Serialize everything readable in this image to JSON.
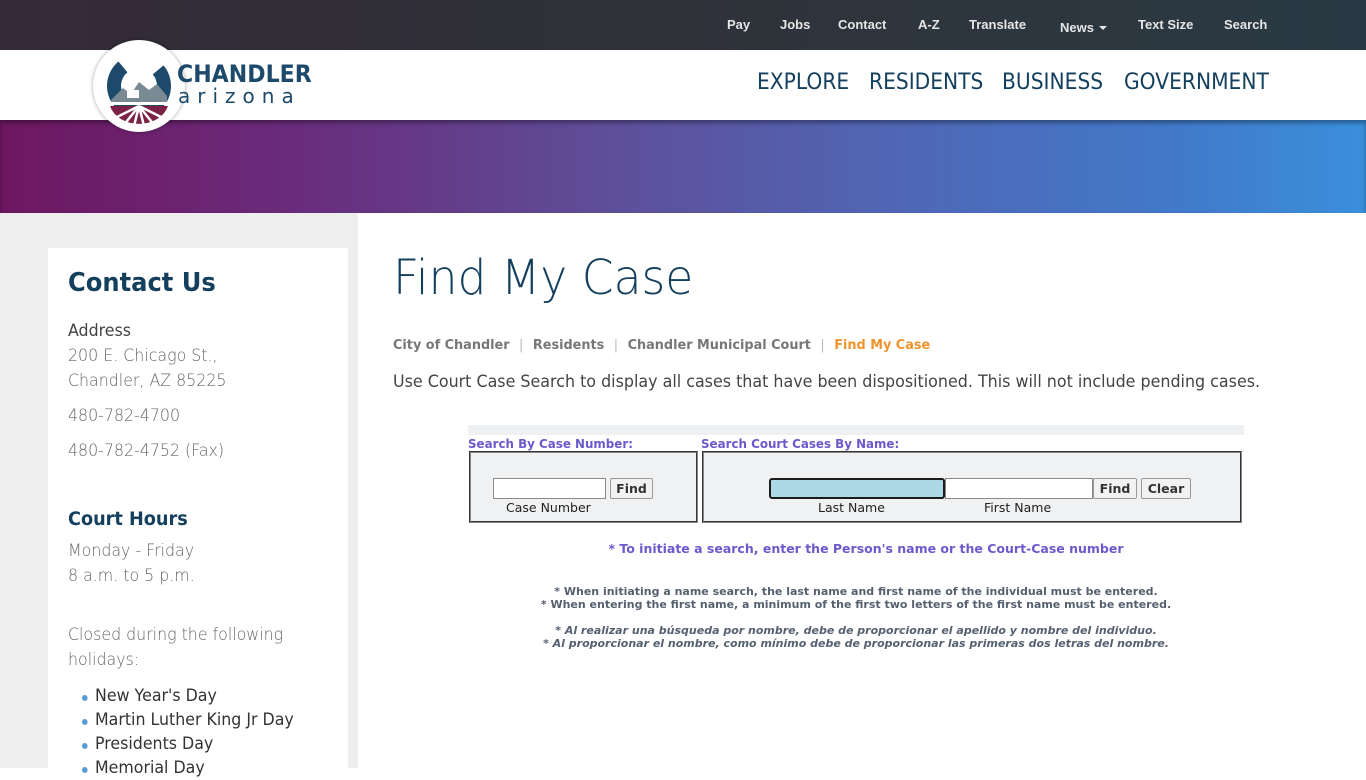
{
  "utility_nav": [
    {
      "label": "Pay"
    },
    {
      "label": "Jobs"
    },
    {
      "label": "Contact"
    },
    {
      "label": "A-Z"
    },
    {
      "label": "Translate"
    },
    {
      "label": "News",
      "has_dropdown": true
    },
    {
      "label": "Text Size"
    },
    {
      "label": "Search"
    }
  ],
  "logo": {
    "line1": "CHANDLER",
    "line2": "arizona"
  },
  "main_nav": [
    {
      "label": "EXPLORE"
    },
    {
      "label": "RESIDENTS"
    },
    {
      "label": "BUSINESS"
    },
    {
      "label": "GOVERNMENT"
    }
  ],
  "sidebar": {
    "title": "Contact Us",
    "address_label": "Address",
    "address_line1": "200 E. Chicago St.,",
    "address_line2": "Chandler, AZ 85225",
    "phone": "480-782-4700",
    "fax": "480-782-4752 (Fax)",
    "hours_title": "Court Hours",
    "hours_days": "Monday - Friday",
    "hours_time": "8 a.m. to 5 p.m.",
    "closed_line1": "Closed during the following",
    "closed_line2": "holidays:",
    "holidays": [
      "New Year's Day",
      "Martin Luther King Jr Day",
      "Presidents Day",
      "Memorial Day"
    ]
  },
  "page": {
    "title": "Find My Case",
    "breadcrumb": [
      {
        "label": "City of Chandler"
      },
      {
        "label": "Residents"
      },
      {
        "label": "Chandler Municipal Court"
      },
      {
        "label": "Find My Case",
        "current": true
      }
    ],
    "intro": "Use Court Case Search to display all cases that have been dispositioned. This will not include pending cases."
  },
  "search_form": {
    "case_section_label": "Search By Case Number:",
    "case_number": {
      "value": "",
      "caption": "Case Number"
    },
    "case_find_label": "Find",
    "name_section_label": "Search Court Cases By Name:",
    "last_name": {
      "value": "",
      "caption": "Last Name"
    },
    "first_name": {
      "value": "",
      "caption": "First Name"
    },
    "name_find_label": "Find",
    "clear_label": "Clear",
    "main_note": "* To initiate a search, enter the Person's name or the Court-Case number",
    "notes_en": [
      "* When initiating a name search, the last name and first name of the individual must be entered.",
      "* When entering the first name, a minimum of the first two letters of the first name must be entered."
    ],
    "notes_es": [
      "* Al realizar una búsqueda por nombre, debe de proporcionar el apellido y nombre del individuo.",
      "* Al proporcionar el nombre, como mínimo debe de proporcionar las primeras dos letras del nombre."
    ]
  },
  "colors": {
    "brand_navy": "#14405e",
    "accent_orange": "#f0932b",
    "form_label_purple": "#6a5acd",
    "focused_input": "#add8e6"
  }
}
